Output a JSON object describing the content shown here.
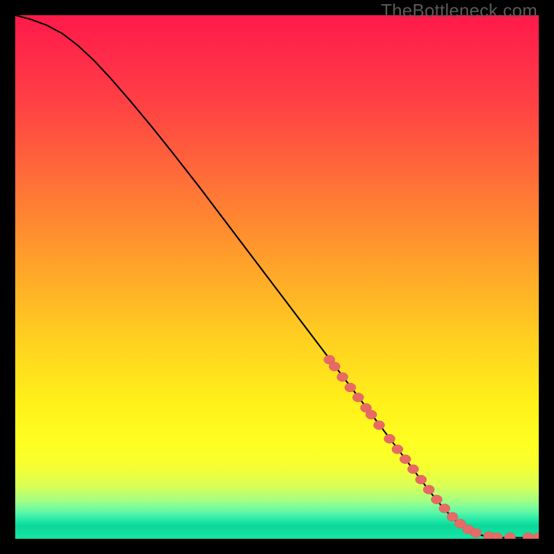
{
  "watermark": "TheBottleneck.com",
  "colors": {
    "curve": "#000000",
    "marker_fill": "#e86a66",
    "marker_stroke": "#d4574f",
    "background_top": "#ff1a4a",
    "background_bottom": "#16e6a6"
  },
  "chart_data": {
    "type": "line",
    "title": "",
    "xlabel": "",
    "ylabel": "",
    "xlim": [
      0,
      100
    ],
    "ylim": [
      0,
      100
    ],
    "grid": false,
    "legend": false,
    "series": [
      {
        "name": "curve",
        "x": [
          0,
          3,
          6,
          9,
          12,
          15,
          18,
          22,
          26,
          30,
          35,
          40,
          45,
          50,
          55,
          60,
          65,
          70,
          75,
          78,
          80,
          82,
          84,
          86,
          88,
          90,
          92,
          94,
          96,
          98,
          100
        ],
        "y": [
          100,
          99.2,
          98.1,
          96.5,
          94.2,
          91.4,
          88.2,
          83.6,
          78.8,
          73.8,
          67.4,
          60.8,
          54.2,
          47.6,
          41.0,
          34.4,
          27.8,
          21.2,
          14.6,
          10.6,
          8.0,
          5.6,
          3.6,
          2.0,
          1.0,
          0.4,
          0.2,
          0.2,
          0.2,
          0.2,
          0.2
        ]
      }
    ],
    "markers": [
      {
        "name": "bottleneck-dots",
        "x": [
          60,
          61,
          62.5,
          64,
          65.5,
          67,
          68,
          69.5,
          71.5,
          73,
          74.5,
          76,
          77.5,
          79,
          80.5,
          82,
          83.5,
          85,
          86.5,
          88,
          90.5,
          92,
          94.5,
          98,
          100
        ],
        "y": [
          34.2,
          32.9,
          30.9,
          28.9,
          27.0,
          25.0,
          23.7,
          21.7,
          19.1,
          17.1,
          15.2,
          13.3,
          11.3,
          9.4,
          7.5,
          5.8,
          4.2,
          2.9,
          1.8,
          1.1,
          0.5,
          0.3,
          0.3,
          0.3,
          0.3
        ]
      }
    ]
  }
}
